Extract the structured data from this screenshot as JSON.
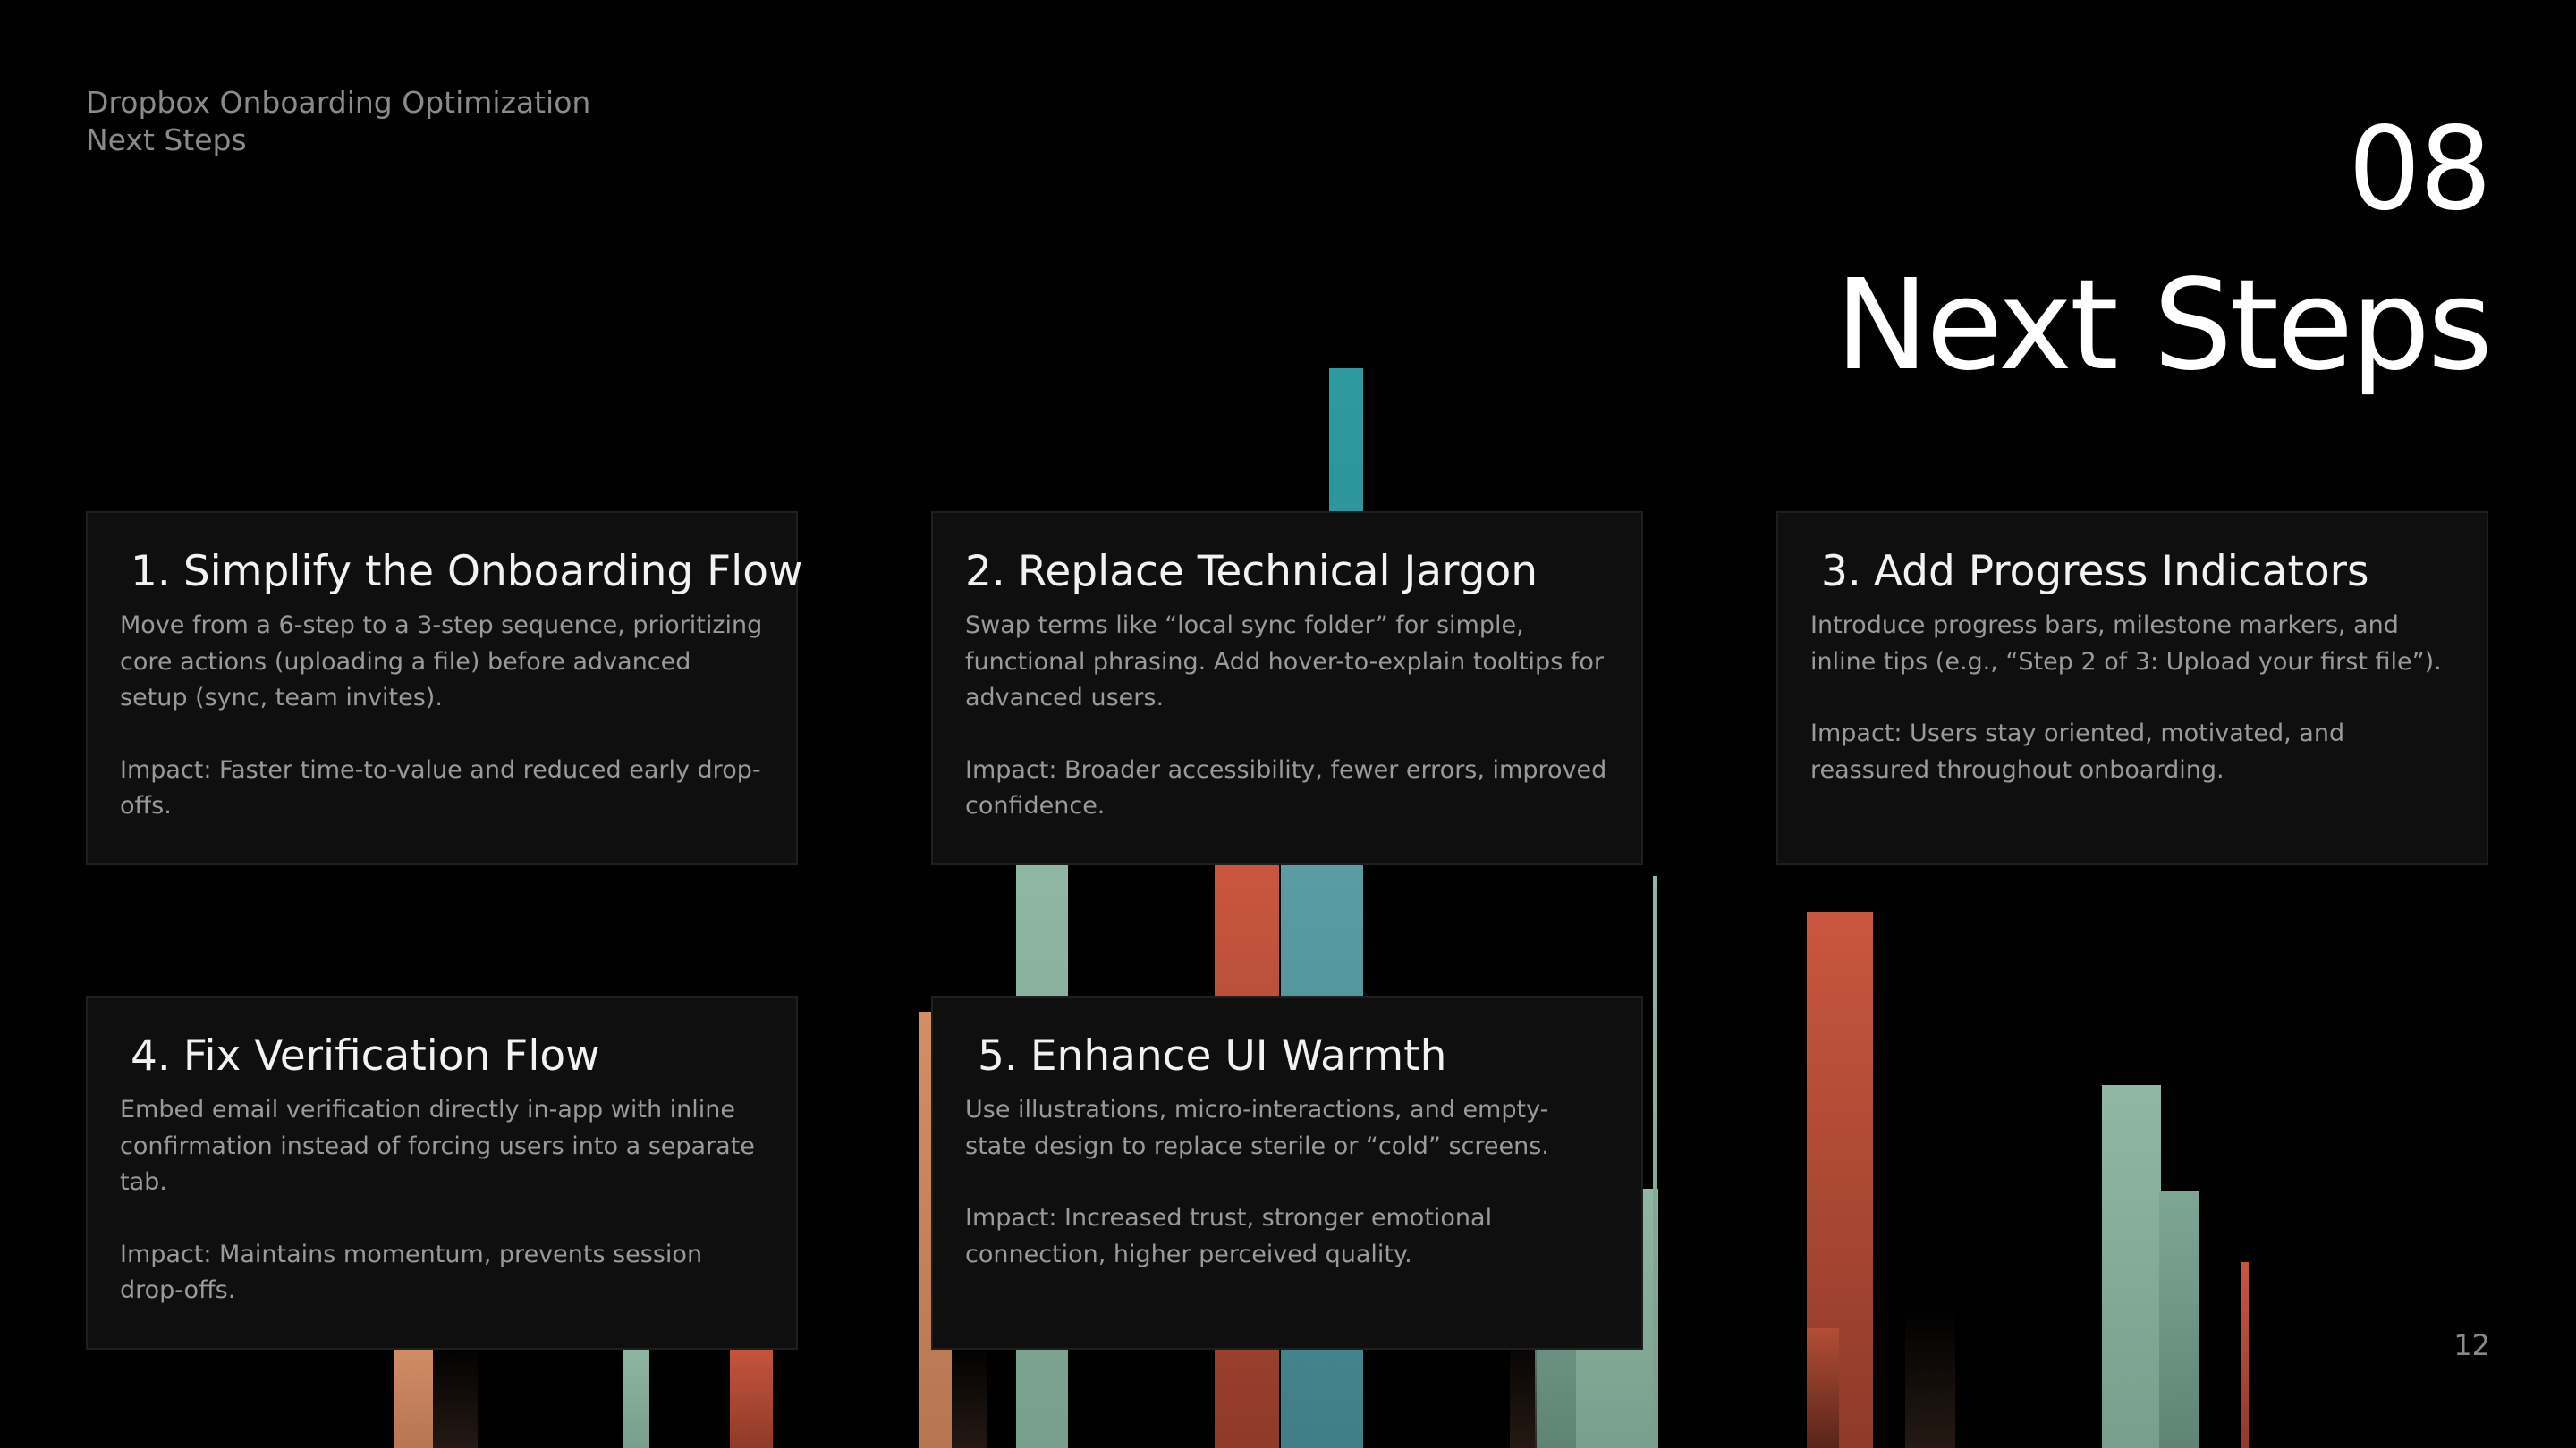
{
  "header": {
    "line1": "Dropbox Onboarding Optimization",
    "line2": "Next Steps"
  },
  "slide": {
    "number": "08",
    "title": "Next Steps",
    "page": "12"
  },
  "cards": [
    {
      "num": "1.",
      "title": "Simplify the Onboarding Flow",
      "body": "Move from a 6-step to a 3-step sequence, prioritizing core actions (uploading a file) before advanced setup (sync, team invites).",
      "impact": "Impact: Faster time-to-value and reduced early drop-offs."
    },
    {
      "num": "2.",
      "title": "Replace Technical Jargon",
      "body": "Swap terms like “local sync folder” for simple, functional phrasing. Add hover-to-explain tooltips for advanced users.",
      "impact": "Impact: Broader accessibility, fewer errors, improved confidence."
    },
    {
      "num": "3.",
      "title": "Add Progress Indicators",
      "body": "Introduce progress bars, milestone markers, and inline tips (e.g., “Step 2 of 3: Upload your first file”).",
      "impact": "Impact: Users stay oriented, motivated, and reassured throughout onboarding."
    },
    {
      "num": "4.",
      "title": "Fix Verification Flow",
      "body": "Embed email verification directly in-app with inline confirmation instead of forcing users into a separate tab.",
      "impact": "Impact: Maintains momentum, prevents session drop-offs."
    },
    {
      "num": "5.",
      "title": "Enhance UI Warmth",
      "body": "Use illustrations, micro-interactions, and empty-state design to replace sterile or “cold” screens.",
      "impact": "Impact: Increased trust, stronger emotional connection, higher perceived quality."
    }
  ],
  "colors": {
    "background": "#000000",
    "card": "#0f0f0f",
    "teal": "#2e9aa0",
    "mint": "#8fb7a3",
    "rust": "#c9573e",
    "peach": "#d28e67"
  }
}
